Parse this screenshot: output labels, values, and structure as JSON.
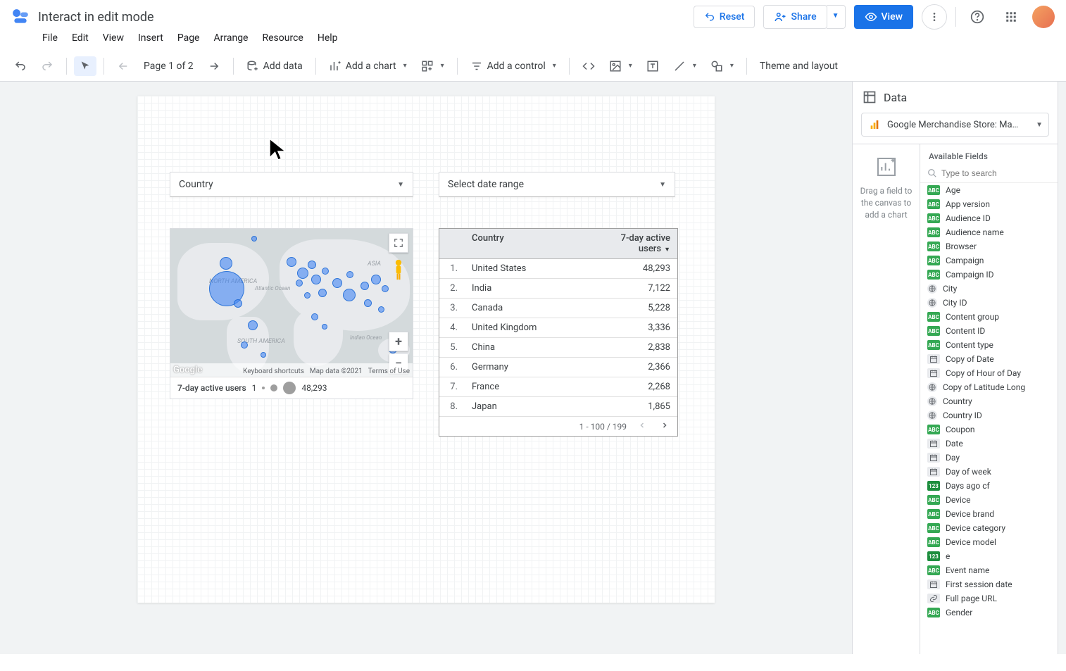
{
  "header": {
    "title": "Interact in edit mode",
    "reset": "Reset",
    "share": "Share",
    "view": "View"
  },
  "menubar": [
    "File",
    "Edit",
    "View",
    "Insert",
    "Page",
    "Arrange",
    "Resource",
    "Help"
  ],
  "toolbar": {
    "page_indicator": "Page 1 of 2",
    "add_data": "Add data",
    "add_chart": "Add a chart",
    "add_control": "Add a control",
    "theme": "Theme and layout"
  },
  "controls": {
    "country_label": "Country",
    "date_label": "Select date range"
  },
  "map": {
    "legend_metric": "7-day active users",
    "legend_min": "1",
    "legend_max": "48,293",
    "attr_shortcuts": "Keyboard shortcuts",
    "attr_mapdata": "Map data ©2021",
    "attr_terms": "Terms of Use",
    "google_logo": "Google",
    "continent_na": "NORTH AMERICA",
    "continent_sa": "SOUTH AMERICA",
    "continent_asia": "ASIA",
    "ocean_atlantic": "Atlantic Ocean",
    "ocean_indian": "Indian Ocean"
  },
  "chart_data": {
    "type": "table",
    "columns": [
      "",
      "Country",
      "7-day active users"
    ],
    "sort_column": "7-day active users",
    "sort_dir": "desc",
    "rows": [
      {
        "idx": "1.",
        "country": "United States",
        "value": "48,293"
      },
      {
        "idx": "2.",
        "country": "India",
        "value": "7,122"
      },
      {
        "idx": "3.",
        "country": "Canada",
        "value": "5,228"
      },
      {
        "idx": "4.",
        "country": "United Kingdom",
        "value": "3,336"
      },
      {
        "idx": "5.",
        "country": "China",
        "value": "2,838"
      },
      {
        "idx": "6.",
        "country": "Germany",
        "value": "2,366"
      },
      {
        "idx": "7.",
        "country": "France",
        "value": "2,268"
      },
      {
        "idx": "8.",
        "country": "Japan",
        "value": "1,865"
      }
    ],
    "pagination": "1 - 100 / 199"
  },
  "side": {
    "title": "Data",
    "datasource": "Google Merchandise Store: Ma…",
    "drop_hint": "Drag a field to the canvas to add a chart",
    "fields_label": "Available Fields",
    "search_placeholder": "Type to search",
    "fields": [
      {
        "t": "abc",
        "n": "Age"
      },
      {
        "t": "abc",
        "n": "App version"
      },
      {
        "t": "abc",
        "n": "Audience ID"
      },
      {
        "t": "abc",
        "n": "Audience name"
      },
      {
        "t": "abc",
        "n": "Browser"
      },
      {
        "t": "abc",
        "n": "Campaign"
      },
      {
        "t": "abc",
        "n": "Campaign ID"
      },
      {
        "t": "geo",
        "n": "City"
      },
      {
        "t": "geo",
        "n": "City ID"
      },
      {
        "t": "abc",
        "n": "Content group"
      },
      {
        "t": "abc",
        "n": "Content ID"
      },
      {
        "t": "abc",
        "n": "Content type"
      },
      {
        "t": "date",
        "n": "Copy of Date"
      },
      {
        "t": "date",
        "n": "Copy of Hour of Day"
      },
      {
        "t": "geo",
        "n": "Copy of Latitude Long"
      },
      {
        "t": "geo",
        "n": "Country"
      },
      {
        "t": "geo",
        "n": "Country ID"
      },
      {
        "t": "abc",
        "n": "Coupon"
      },
      {
        "t": "date",
        "n": "Date"
      },
      {
        "t": "date",
        "n": "Day"
      },
      {
        "t": "date",
        "n": "Day of week"
      },
      {
        "t": "123",
        "n": "Days ago cf"
      },
      {
        "t": "abc",
        "n": "Device"
      },
      {
        "t": "abc",
        "n": "Device brand"
      },
      {
        "t": "abc",
        "n": "Device category"
      },
      {
        "t": "abc",
        "n": "Device model"
      },
      {
        "t": "123",
        "n": "e"
      },
      {
        "t": "abc",
        "n": "Event name"
      },
      {
        "t": "date",
        "n": "First session date"
      },
      {
        "t": "link",
        "n": "Full page URL"
      },
      {
        "t": "abc",
        "n": "Gender"
      }
    ]
  }
}
